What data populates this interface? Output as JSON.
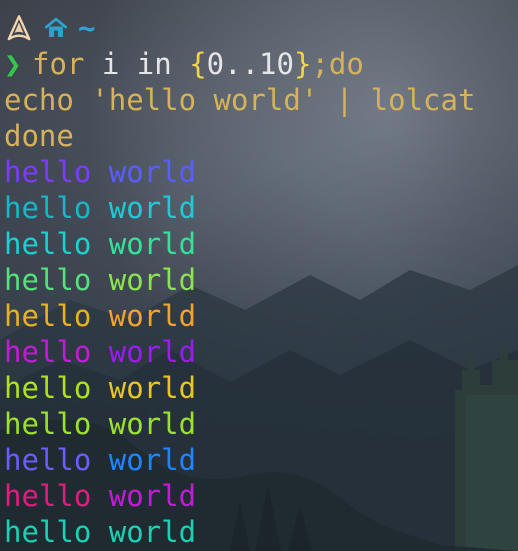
{
  "prompt": {
    "cwd": "~",
    "symbol": "❯"
  },
  "command": {
    "line1": {
      "for": "for",
      "i": "i",
      "in": "in",
      "brace_open": "{",
      "range": "0..10",
      "brace_close": "}",
      "semi_do": ";do"
    },
    "line2": "echo 'hello world' | lolcat",
    "line3": "done"
  },
  "output": {
    "lines": [
      {
        "left": "hello",
        "right": "world",
        "left_color": "#7a3cff",
        "right_color": "#5a5dff"
      },
      {
        "left": "hello",
        "right": "world",
        "left_color": "#18b7c7",
        "right_color": "#1fc9d6"
      },
      {
        "left": "hello",
        "right": "world",
        "left_color": "#19d1d1",
        "right_color": "#35e09a"
      },
      {
        "left": "hello",
        "right": "world",
        "left_color": "#54e27c",
        "right_color": "#8be34f"
      },
      {
        "left": "hello",
        "right": "world",
        "left_color": "#e7b21d",
        "right_color": "#f3a22b"
      },
      {
        "left": "hello",
        "right": "world",
        "left_color": "#c21bd6",
        "right_color": "#9a1cf1"
      },
      {
        "left": "hello",
        "right": "world",
        "left_color": "#b0e21b",
        "right_color": "#e8c51f"
      },
      {
        "left": "hello",
        "right": "world",
        "left_color": "#9be22a",
        "right_color": "#9be22a"
      },
      {
        "left": "hello",
        "right": "world",
        "left_color": "#6b5cff",
        "right_color": "#1d86ff"
      },
      {
        "left": "hello",
        "right": "world",
        "left_color": "#e11c7e",
        "right_color": "#c21bd6"
      },
      {
        "left": "hello",
        "right": "world",
        "left_color": "#19d1b4",
        "right_color": "#19d1b4"
      }
    ]
  },
  "colors": {
    "arch_logo": "#f1d6b0",
    "home_icon": "#2aa7d6",
    "chevron": "#34c84a"
  },
  "icons": {
    "arch": "arch-linux-logo-icon",
    "home": "home-icon"
  }
}
